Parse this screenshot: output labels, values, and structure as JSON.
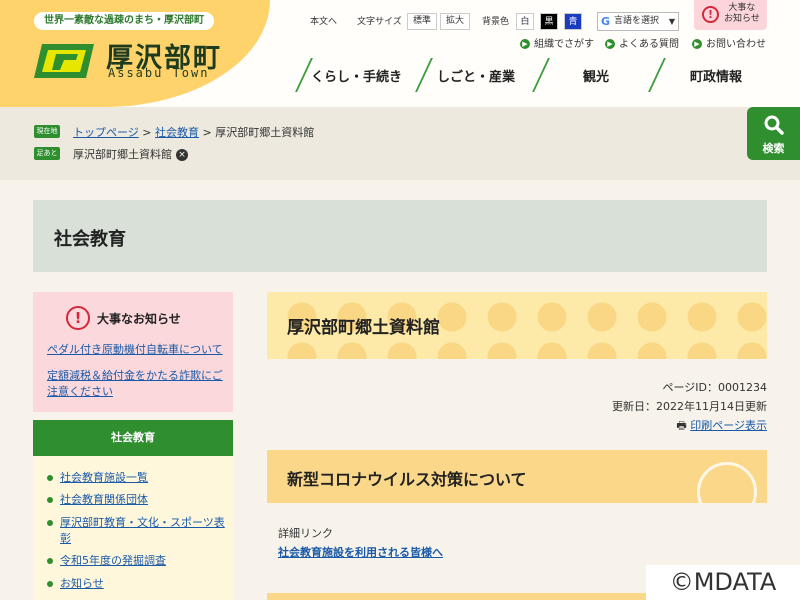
{
  "header": {
    "tagline": "世界一素敵な過疎のまち・厚沢部町",
    "town_name": "厚沢部町",
    "town_roman": "Assabu Town",
    "utility": {
      "body_text_link": "本文へ",
      "font_size_label": "文字サイズ",
      "font_standard": "標準",
      "font_large": "拡大",
      "bg_color_label": "背景色",
      "bg_white": "白",
      "bg_black": "黒",
      "bg_blue": "青",
      "lang_select": "言語を選択",
      "lang_arrow": "▼"
    },
    "alert": {
      "icon": "!",
      "line1": "大事な",
      "line2": "お知らせ"
    },
    "quick_links": [
      "組織でさがす",
      "よくある質問",
      "お問い合わせ"
    ],
    "global_nav": [
      "くらし・手続き",
      "しごと・産業",
      "観光",
      "町政情報"
    ]
  },
  "breadcrumb": {
    "current_tag": "現在地",
    "items": [
      "トップページ",
      "社会教育"
    ],
    "separator": ">",
    "current": "厚沢部町郷土資料館",
    "history_tag": "足あと",
    "history_item": "厚沢部町郷土資料館",
    "remove_icon": "×"
  },
  "search": {
    "label": "検索"
  },
  "section_title": "社会教育",
  "notice": {
    "icon": "!",
    "title": "大事なお知らせ",
    "links": [
      "ペダル付き原動機付自転車について",
      "定額減税＆給付金をかたる詐欺にご注意ください"
    ]
  },
  "side_nav": {
    "heading": "社会教育",
    "items": [
      "社会教育施設一覧",
      "社会教育関係団体",
      "厚沢部町教育・文化・スポーツ表彰",
      "令和5年度の発掘調査",
      "お知らせ"
    ]
  },
  "main": {
    "page_title": "厚沢部町郷土資料館",
    "page_id": "ページID：0001234",
    "updated": "更新日：2022年11月14日更新",
    "print_link": "印刷ページ表示",
    "corona_title": "新型コロナウイルス対策について",
    "detail_label": "詳細リンク",
    "detail_link": "社会教育施設を利用される皆様へ"
  },
  "watermark": "©MDATA",
  "colors": {
    "green": "#2f8f2f",
    "yellow": "#ffd36b",
    "pink": "#fbd8db",
    "link": "#1a5aa8"
  }
}
